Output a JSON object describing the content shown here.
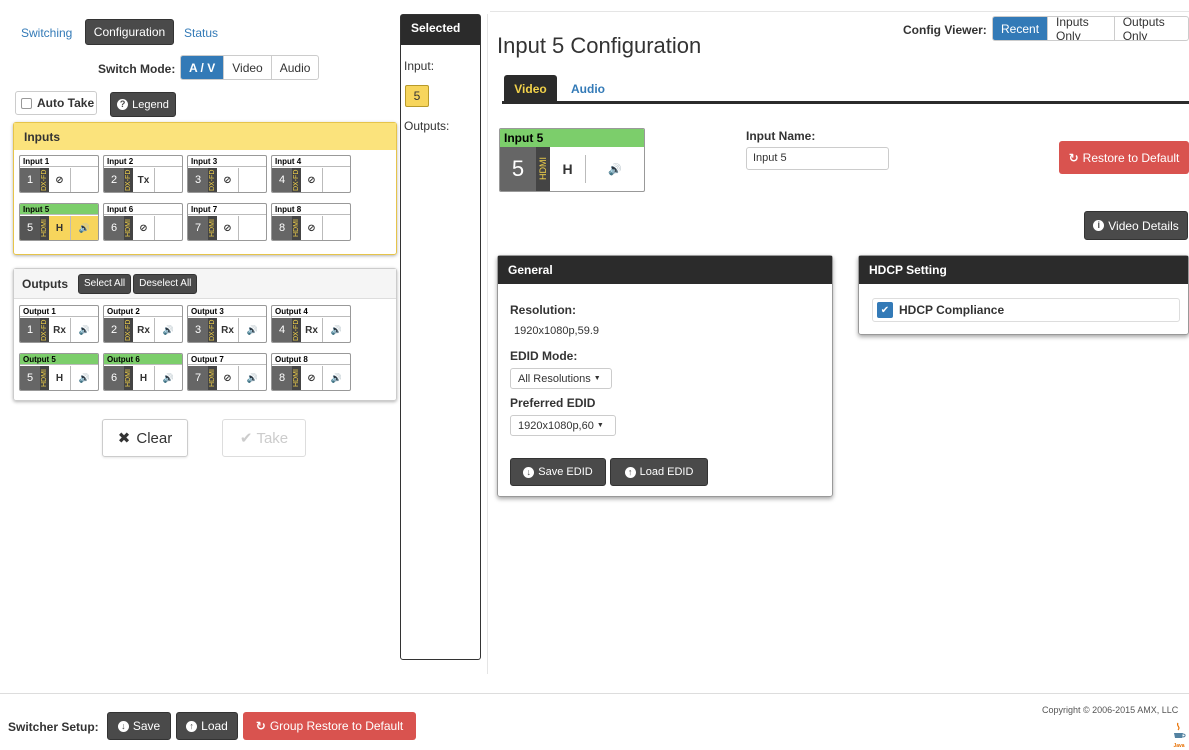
{
  "nav": {
    "switching": "Switching",
    "configuration": "Configuration",
    "status": "Status"
  },
  "switch_mode": {
    "label": "Switch Mode:",
    "options": [
      "A / V",
      "Video",
      "Audio"
    ]
  },
  "auto_take": "Auto Take",
  "legend_btn": "Legend",
  "inputs": {
    "title": "Inputs",
    "tiles": [
      {
        "name": "Input 1",
        "num": "1",
        "type": "DX-FD",
        "sig": "⊘",
        "audio": ""
      },
      {
        "name": "Input 2",
        "num": "2",
        "type": "DX-FD",
        "sig": "Tx",
        "audio": ""
      },
      {
        "name": "Input 3",
        "num": "3",
        "type": "DX-FD",
        "sig": "⊘",
        "audio": ""
      },
      {
        "name": "Input 4",
        "num": "4",
        "type": "DX-FD",
        "sig": "⊘",
        "audio": ""
      },
      {
        "name": "Input 5",
        "num": "5",
        "type": "HDMI",
        "sig": "H",
        "audio": "🔊"
      },
      {
        "name": "Input 6",
        "num": "6",
        "type": "HDMI",
        "sig": "⊘",
        "audio": ""
      },
      {
        "name": "Input 7",
        "num": "7",
        "type": "HDMI",
        "sig": "⊘",
        "audio": ""
      },
      {
        "name": "Input 8",
        "num": "8",
        "type": "HDMI",
        "sig": "⊘",
        "audio": ""
      }
    ]
  },
  "outputs": {
    "title": "Outputs",
    "select_all": "Select All",
    "deselect_all": "Deselect All",
    "tiles": [
      {
        "name": "Output 1",
        "num": "1",
        "type": "DX-FD",
        "sig": "Rx",
        "audio": "🔊"
      },
      {
        "name": "Output 2",
        "num": "2",
        "type": "DX-FD",
        "sig": "Rx",
        "audio": "🔊"
      },
      {
        "name": "Output 3",
        "num": "3",
        "type": "DX-FD",
        "sig": "Rx",
        "audio": "🔊"
      },
      {
        "name": "Output 4",
        "num": "4",
        "type": "DX-FD",
        "sig": "Rx",
        "audio": "🔊"
      },
      {
        "name": "Output 5",
        "num": "5",
        "type": "HDMI",
        "sig": "H",
        "audio": "🔊"
      },
      {
        "name": "Output 6",
        "num": "6",
        "type": "HDMI",
        "sig": "H",
        "audio": "🔊"
      },
      {
        "name": "Output 7",
        "num": "7",
        "type": "HDMI",
        "sig": "⊘",
        "audio": "🔊"
      },
      {
        "name": "Output 8",
        "num": "8",
        "type": "HDMI",
        "sig": "⊘",
        "audio": "🔊"
      }
    ]
  },
  "clear_btn": "Clear",
  "take_btn": "Take",
  "selected": {
    "title": "Selected",
    "input_label": "Input:",
    "input_value": "5",
    "outputs_label": "Outputs:"
  },
  "config_viewer": {
    "label": "Config Viewer:",
    "options": [
      "Recent",
      "Inputs Only",
      "Outputs Only"
    ]
  },
  "page_title": "Input 5 Configuration",
  "tabs": [
    "Video",
    "Audio"
  ],
  "big_tile": {
    "name": "Input 5",
    "num": "5",
    "type": "HDMI",
    "sig": "H",
    "audio": "🔊"
  },
  "input_name": {
    "label": "Input Name:",
    "value": "Input 5"
  },
  "restore_btn": "Restore to Default",
  "video_details_btn": "Video Details",
  "general": {
    "title": "General",
    "resolution_label": "Resolution:",
    "resolution_value": "1920x1080p,59.9",
    "edid_mode_label": "EDID Mode:",
    "edid_mode_value": "All Resolutions",
    "preferred_edid_label": "Preferred EDID",
    "preferred_edid_value": "1920x1080p,60",
    "save_edid": "Save EDID",
    "load_edid": "Load EDID"
  },
  "hdcp": {
    "title": "HDCP Setting",
    "compliance_label": "HDCP Compliance",
    "checked": true
  },
  "footer": {
    "setup_label": "Switcher Setup:",
    "save": "Save",
    "load": "Load",
    "group_restore": "Group Restore to Default",
    "copyright": "Copyright © 2006-2015 AMX, LLC",
    "java_label": "Java"
  },
  "colors": {
    "accent": "#337ab7",
    "danger": "#d9534f",
    "selected": "#f7d55c",
    "active_tile": "#7cce6b",
    "dark": "#4a4a4a"
  }
}
